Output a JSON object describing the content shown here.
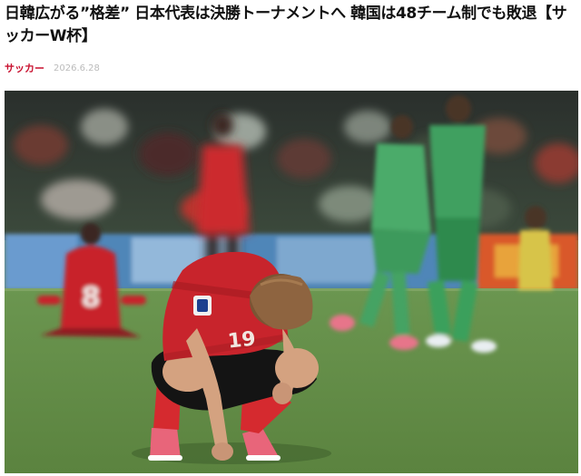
{
  "article": {
    "title": "日韓広がる”格差” 日本代表は決勝トーナメントへ 韓国は48チーム制でも敗退【サッカーW杯】",
    "category": "サッカー",
    "date": "2026.6.28"
  },
  "photo": {
    "icons": [
      "player-crouching-figure",
      "player-number-19",
      "player-number-8"
    ],
    "shirt_numbers": {
      "crouching_player": "19",
      "background_player": "8"
    },
    "colors": {
      "pitch": "#5f8a46",
      "red_kit": "#c8242c",
      "green_kit": "#3fa061",
      "accent": "#c8102e"
    }
  }
}
